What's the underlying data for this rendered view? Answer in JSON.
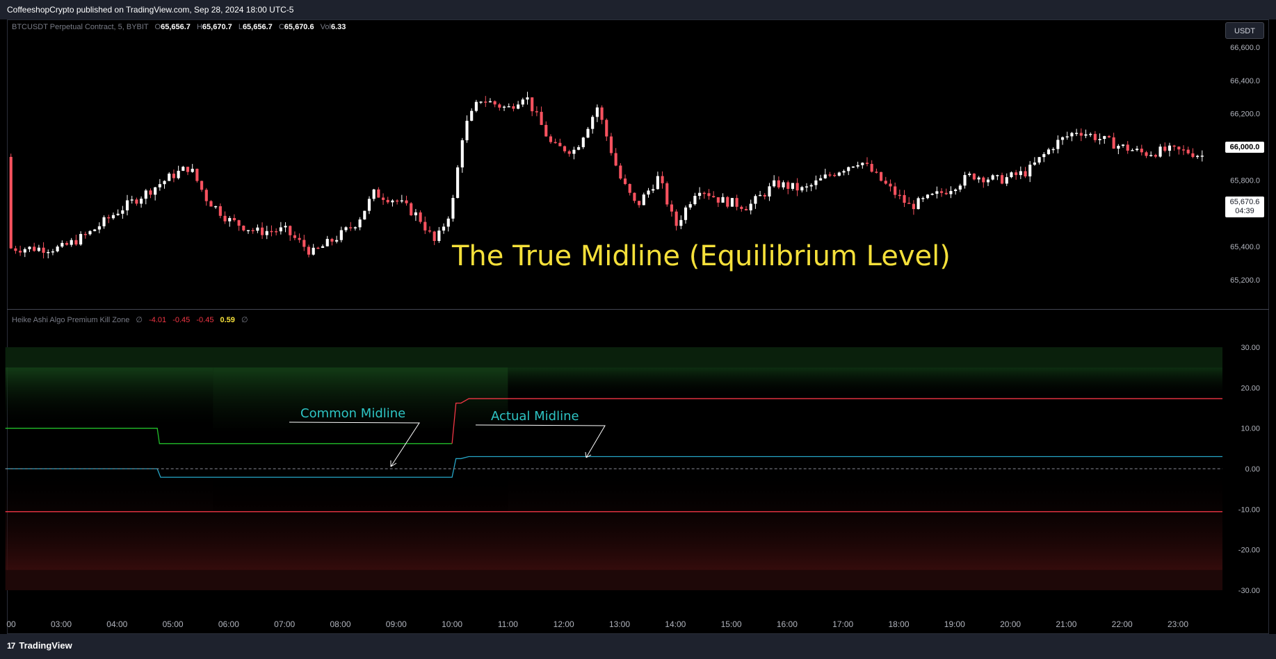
{
  "header": {
    "publisher_line": "CoffeeshopCrypto published on TradingView.com, Sep 28, 2024 18:00 UTC-5"
  },
  "footer": {
    "brand": "TradingView",
    "logo_glyph": "17"
  },
  "symbol_legend": {
    "symbol": "BTCUSDT Perpetual Contract, 5, BYBIT",
    "o_label": "O",
    "o": "65,656.7",
    "h_label": "H",
    "h": "65,670.7",
    "l_label": "L",
    "l": "65,656.7",
    "c_label": "C",
    "c": "65,670.6",
    "vol_label": "Vol",
    "vol": "6.33"
  },
  "currency_button": "USDT",
  "price_labels": {
    "current": "66,000.0",
    "last": "65,670.6",
    "countdown": "04:39"
  },
  "indicator_legend": {
    "name": "Heike Ashi Algo Premium Kill Zone",
    "sym1": "∅",
    "v1": "-4.01",
    "v2": "-0.45",
    "v3": "-0.45",
    "v4": "0.59",
    "sym2": "∅"
  },
  "annotations": {
    "title": "The True Midline (Equilibrium Level)",
    "common_midline": "Common Midline",
    "actual_midline": "Actual Midline"
  },
  "colors": {
    "bull_candle": "#ffffff",
    "bear_candle": "#f7525f",
    "green_line": "#22c02a",
    "red_line": "#f23645",
    "midline": "#26a6c7",
    "annotation": "#2ec4c4",
    "title": "#f5e03a"
  },
  "chart_data": [
    {
      "type": "candlestick",
      "title": "BTCUSDT Perpetual Contract, 5, BYBIT",
      "ylim": [
        65100,
        66650
      ],
      "y_ticks": [
        "66,600.0",
        "66,400.0",
        "66,200.0",
        "65,800.0",
        "65,400.0",
        "65,200.0"
      ],
      "y_tick_values": [
        66600,
        66400,
        66200,
        65800,
        65400,
        65200
      ],
      "x_ticks": [
        "00",
        "03:00",
        "04:00",
        "05:00",
        "06:00",
        "07:00",
        "08:00",
        "09:00",
        "10:00",
        "11:00",
        "12:00",
        "13:00",
        "14:00",
        "15:00",
        "16:00",
        "17:00",
        "18:00",
        "19:00",
        "20:00",
        "21:00",
        "22:00",
        "23:00"
      ],
      "trend_close": [
        [
          0.0,
          65390
        ],
        [
          0.5,
          65480
        ],
        [
          1.0,
          65610
        ],
        [
          1.5,
          65720
        ],
        [
          2.0,
          65830
        ],
        [
          2.3,
          65880
        ],
        [
          2.6,
          65690
        ],
        [
          3.0,
          65560
        ],
        [
          3.5,
          65490
        ],
        [
          4.0,
          65500
        ],
        [
          4.5,
          65360
        ],
        [
          5.0,
          65470
        ],
        [
          5.3,
          65550
        ],
        [
          5.6,
          65720
        ],
        [
          6.0,
          65680
        ],
        [
          6.4,
          65580
        ],
        [
          6.7,
          65420
        ],
        [
          7.0,
          65640
        ],
        [
          7.2,
          66100
        ],
        [
          7.5,
          66290
        ],
        [
          8.0,
          66230
        ],
        [
          8.3,
          66320
        ],
        [
          8.8,
          66000
        ],
        [
          9.2,
          65980
        ],
        [
          9.6,
          66240
        ],
        [
          10.0,
          65820
        ],
        [
          10.3,
          65640
        ],
        [
          10.7,
          65820
        ],
        [
          11.0,
          65520
        ],
        [
          11.4,
          65760
        ],
        [
          11.8,
          65680
        ],
        [
          12.3,
          65640
        ],
        [
          12.8,
          65780
        ],
        [
          13.3,
          65740
        ],
        [
          13.8,
          65840
        ],
        [
          14.3,
          65920
        ],
        [
          14.8,
          65760
        ],
        [
          15.2,
          65640
        ],
        [
          15.8,
          65730
        ],
        [
          16.3,
          65830
        ],
        [
          16.8,
          65800
        ],
        [
          17.3,
          65850
        ],
        [
          17.8,
          66020
        ],
        [
          18.2,
          66100
        ],
        [
          18.6,
          66050
        ],
        [
          19.0,
          66000
        ],
        [
          19.4,
          65960
        ],
        [
          19.8,
          65980
        ],
        [
          20.2,
          65970
        ],
        [
          20.5,
          65940
        ]
      ]
    },
    {
      "type": "line",
      "title": "Heike Ashi Algo Premium Kill Zone",
      "ylim": [
        -30,
        30
      ],
      "y_ticks": [
        "30.00",
        "20.00",
        "10.00",
        "0.00",
        "-10.00",
        "-20.00",
        "-30.00"
      ],
      "y_tick_values": [
        30,
        20,
        10,
        0,
        -10,
        -20,
        -30
      ],
      "zones": [
        {
          "from": 25,
          "to": 30,
          "color": "green"
        },
        {
          "from": -30,
          "to": -25,
          "color": "red"
        }
      ],
      "series": [
        {
          "color": "green",
          "points": [
            [
              0.0,
              10.0
            ],
            [
              2.72,
              10.0
            ],
            [
              2.76,
              6.2
            ],
            [
              8.0,
              6.2
            ]
          ]
        },
        {
          "color": "red",
          "points": [
            [
              8.0,
              6.2
            ],
            [
              8.07,
              16.2
            ],
            [
              8.16,
              16.2
            ],
            [
              8.3,
              17.3
            ],
            [
              21.82,
              17.3
            ]
          ]
        },
        {
          "color": "blue",
          "points": [
            [
              0.0,
              0.0
            ],
            [
              2.72,
              0.0
            ],
            [
              2.78,
              -2.1
            ],
            [
              8.0,
              -2.1
            ],
            [
              8.07,
              2.5
            ],
            [
              8.16,
              2.5
            ],
            [
              8.3,
              3.0
            ],
            [
              21.82,
              3.0
            ]
          ]
        },
        {
          "color": "red",
          "points": [
            [
              0.0,
              -10.6
            ],
            [
              21.82,
              -10.6
            ]
          ]
        },
        {
          "color": "grey-dashed",
          "points": [
            [
              0.0,
              0.0
            ],
            [
              21.82,
              0.0
            ]
          ]
        }
      ]
    }
  ]
}
